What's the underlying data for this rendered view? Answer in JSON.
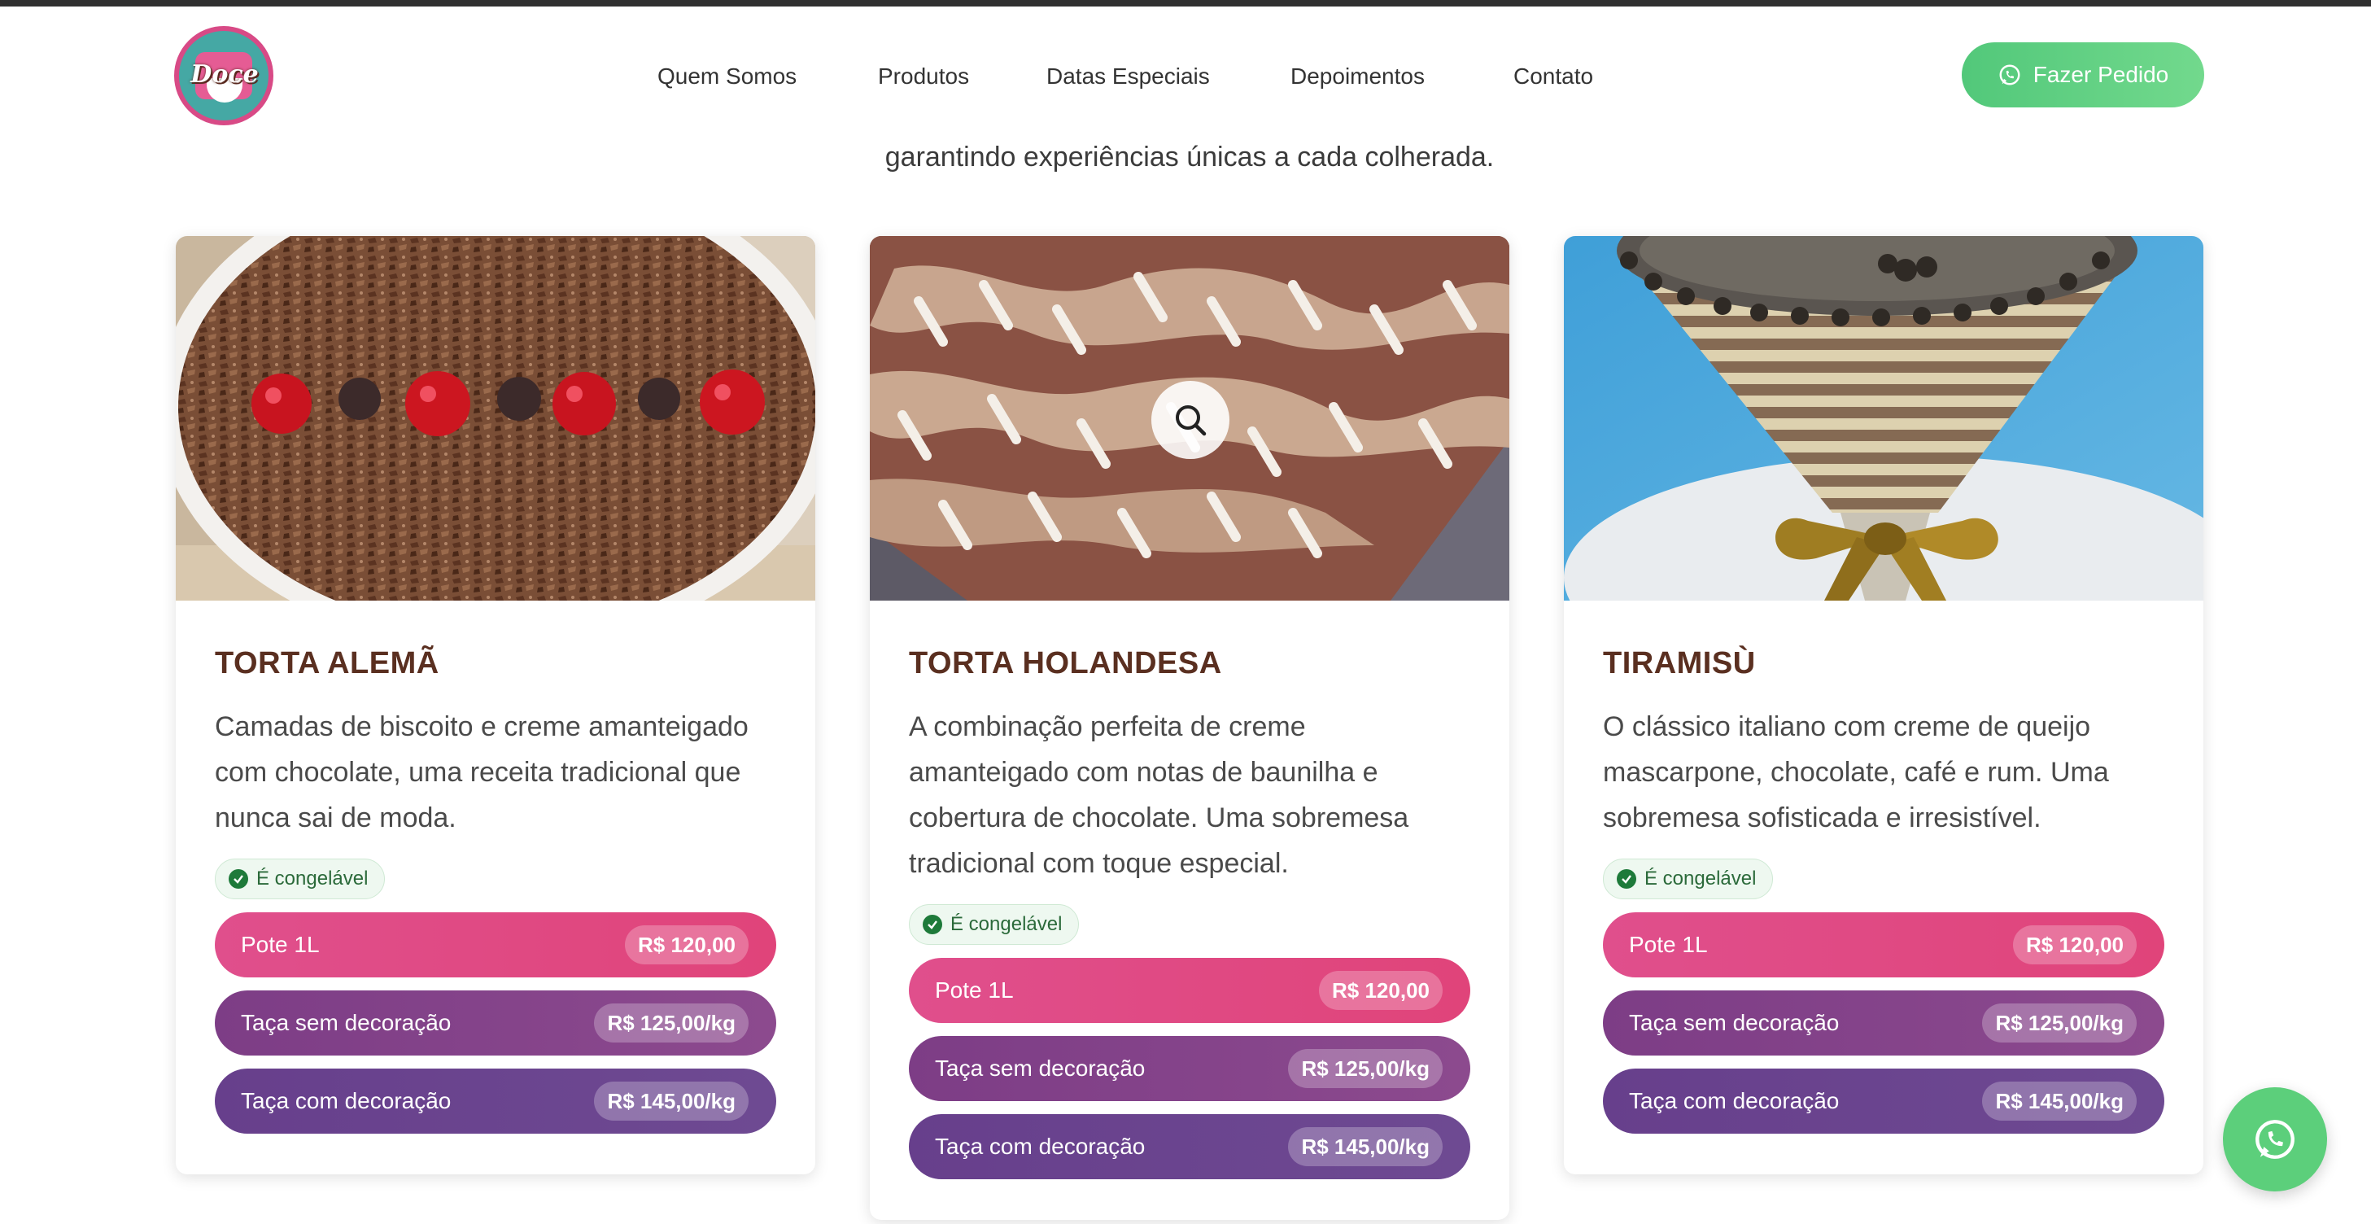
{
  "header": {
    "logo_text": "Doce",
    "nav": [
      "Quem Somos",
      "Produtos",
      "Datas Especiais",
      "Depoimentos",
      "Contato"
    ],
    "cta_label": "Fazer Pedido"
  },
  "intro_text": "garantindo experiências únicas a cada colherada.",
  "products": [
    {
      "name": "TORTA ALEMÃ",
      "description": "Camadas de biscoito e creme amanteigado com chocolate, uma receita tradicional que nunca sai de moda.",
      "badge": "É congelável",
      "prices": [
        {
          "label": "Pote 1L",
          "value": "R$ 120,00"
        },
        {
          "label": "Taça sem decoração",
          "value": "R$ 125,00/kg"
        },
        {
          "label": "Taça com decoração",
          "value": "R$ 145,00/kg"
        }
      ]
    },
    {
      "name": "TORTA HOLANDESA",
      "description": "A combinação perfeita de creme amanteigado com notas de baunilha e cobertura de chocolate. Uma sobremesa tradicional com toque especial.",
      "badge": "É congelável",
      "prices": [
        {
          "label": "Pote 1L",
          "value": "R$ 120,00"
        },
        {
          "label": "Taça sem decoração",
          "value": "R$ 125,00/kg"
        },
        {
          "label": "Taça com decoração",
          "value": "R$ 145,00/kg"
        }
      ]
    },
    {
      "name": "TIRAMISÙ",
      "description": "O clássico italiano com creme de queijo mascarpone, chocolate, café e rum. Uma sobremesa sofisticada e irresistível.",
      "badge": "É congelável",
      "prices": [
        {
          "label": "Pote 1L",
          "value": "R$ 120,00"
        },
        {
          "label": "Taça sem decoração",
          "value": "R$ 125,00/kg"
        },
        {
          "label": "Taça com decoração",
          "value": "R$ 145,00/kg"
        }
      ]
    }
  ],
  "colors": {
    "cta_green": "#52c87a",
    "pink": "#e04f8c",
    "purple": "#7d3d86",
    "deep_purple": "#673f8c",
    "title_brown": "#5a2f20"
  },
  "icons": [
    "whatsapp-icon",
    "search-icon",
    "check-icon"
  ]
}
